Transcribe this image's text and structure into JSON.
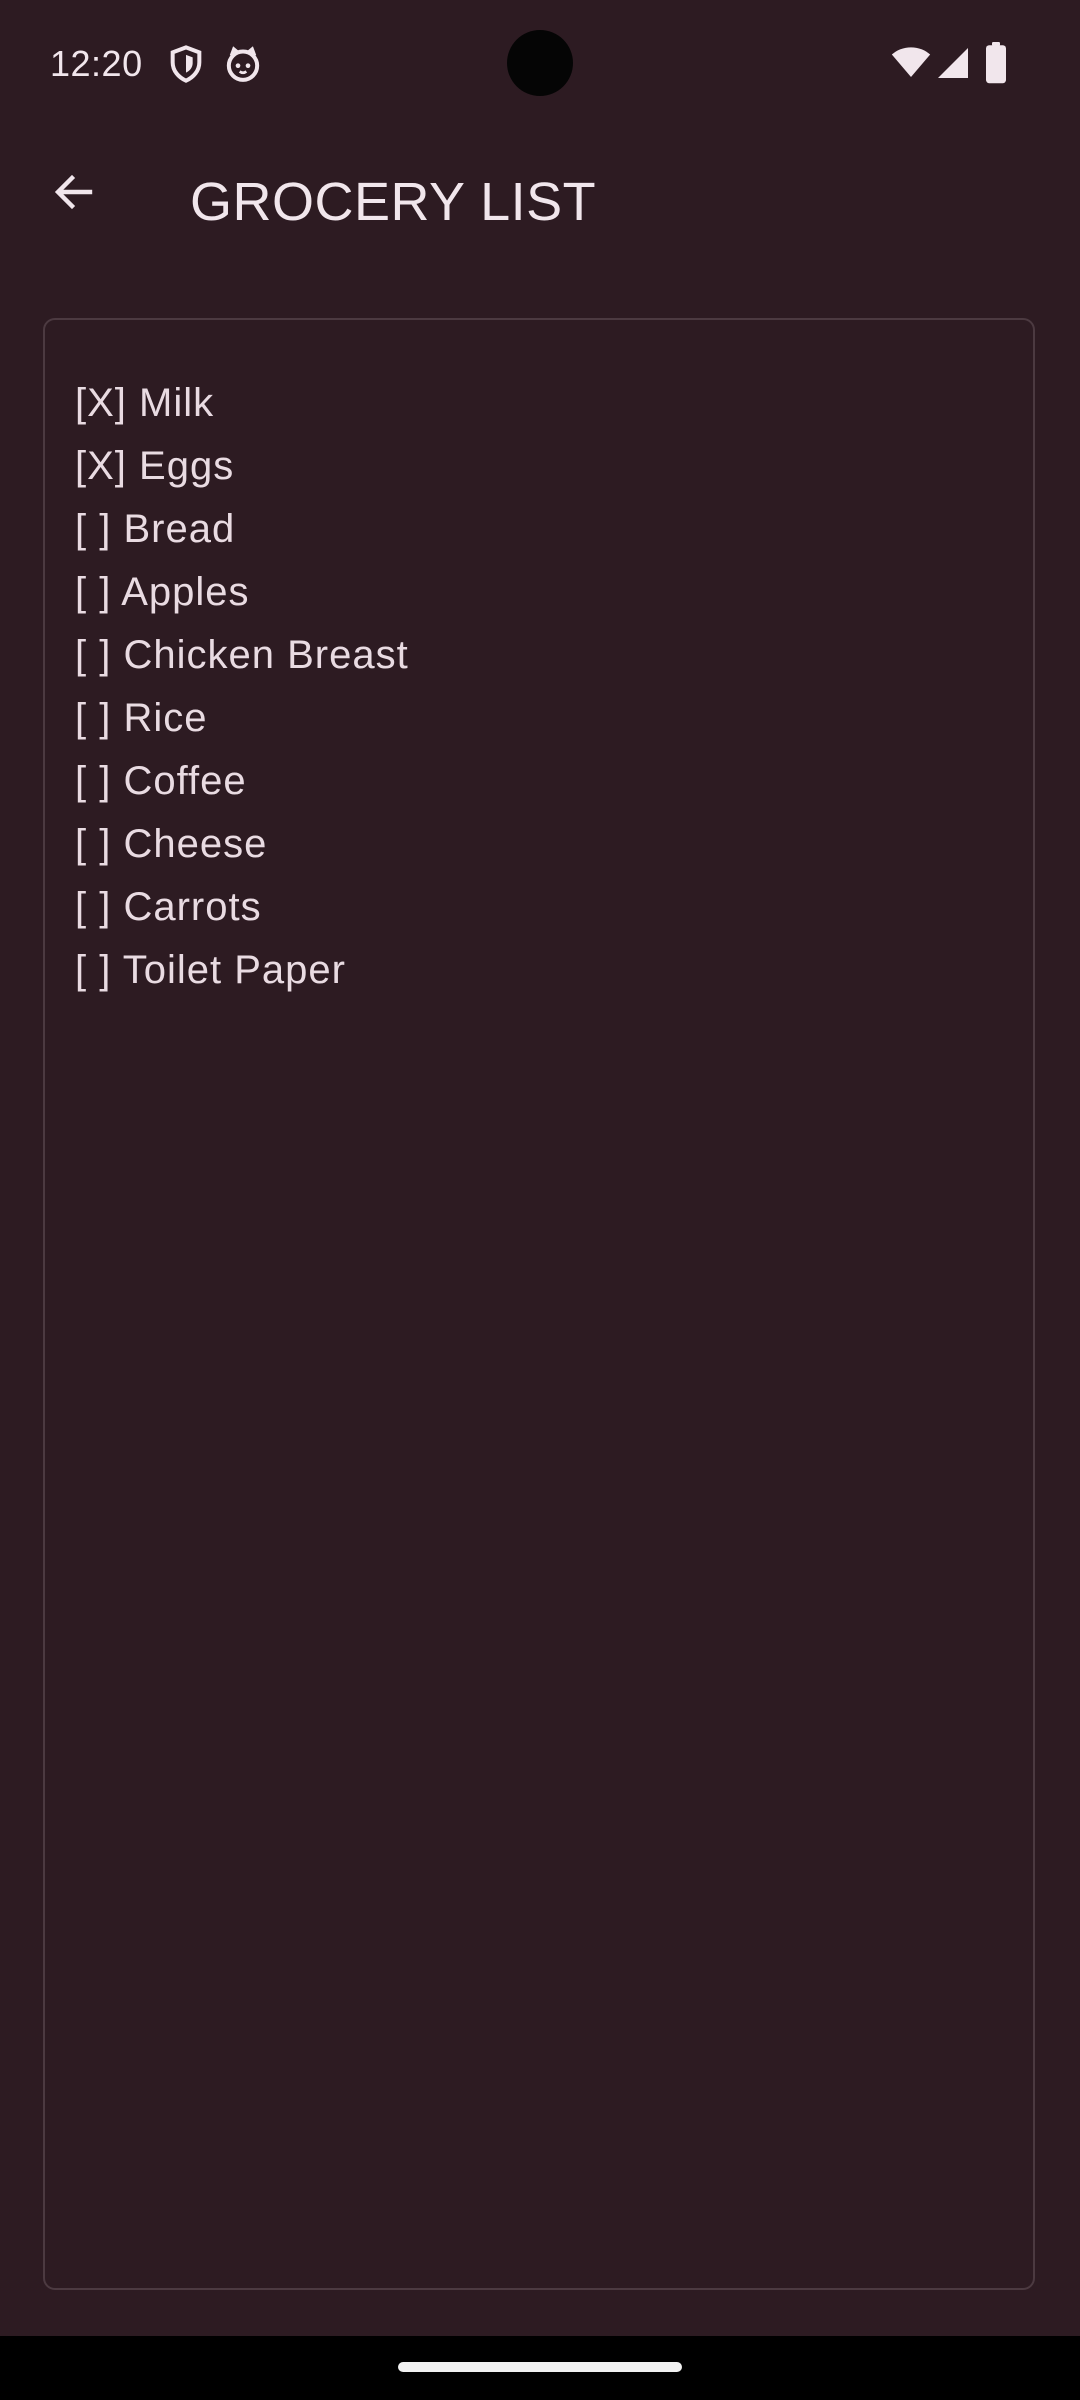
{
  "status_bar": {
    "time": "12:20",
    "left_icons": [
      "shield-icon",
      "cat-face-icon"
    ],
    "right_icons": [
      "wifi-icon",
      "cellular-signal-icon",
      "battery-icon"
    ]
  },
  "app_bar": {
    "back_icon": "arrow-back-icon",
    "title": "GROCERY LIST"
  },
  "note": {
    "lines": [
      "[X] Milk",
      "[X] Eggs",
      "[ ] Bread",
      "[ ] Apples",
      "[ ] Chicken Breast",
      "[ ] Rice",
      "[ ] Coffee",
      "[ ] Cheese",
      "[ ] Carrots",
      "[ ] Toilet Paper"
    ]
  },
  "colors": {
    "background": "#2d1b22",
    "text": "#e9dbe2",
    "border": "#4c3a41",
    "nav_bar": "#000000"
  }
}
